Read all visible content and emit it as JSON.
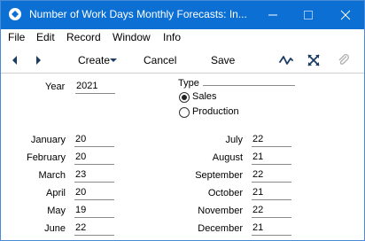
{
  "window": {
    "title": "Number of Work Days Monthly Forecasts: In..."
  },
  "menu": {
    "items": [
      "File",
      "Edit",
      "Record",
      "Window",
      "Info"
    ]
  },
  "toolbar": {
    "create_label": "Create",
    "cancel_label": "Cancel",
    "save_label": "Save"
  },
  "form": {
    "year_label": "Year",
    "year_value": "2021",
    "type_label": "Type",
    "type_options": [
      "Sales",
      "Production"
    ],
    "type_selected": "Sales",
    "months_left": [
      {
        "label": "January",
        "value": "20"
      },
      {
        "label": "February",
        "value": "20"
      },
      {
        "label": "March",
        "value": "23"
      },
      {
        "label": "April",
        "value": "20"
      },
      {
        "label": "May",
        "value": "19"
      },
      {
        "label": "June",
        "value": "22"
      }
    ],
    "months_right": [
      {
        "label": "July",
        "value": "22"
      },
      {
        "label": "August",
        "value": "21"
      },
      {
        "label": "September",
        "value": "22"
      },
      {
        "label": "October",
        "value": "21"
      },
      {
        "label": "November",
        "value": "22"
      },
      {
        "label": "December",
        "value": "21"
      }
    ]
  }
}
